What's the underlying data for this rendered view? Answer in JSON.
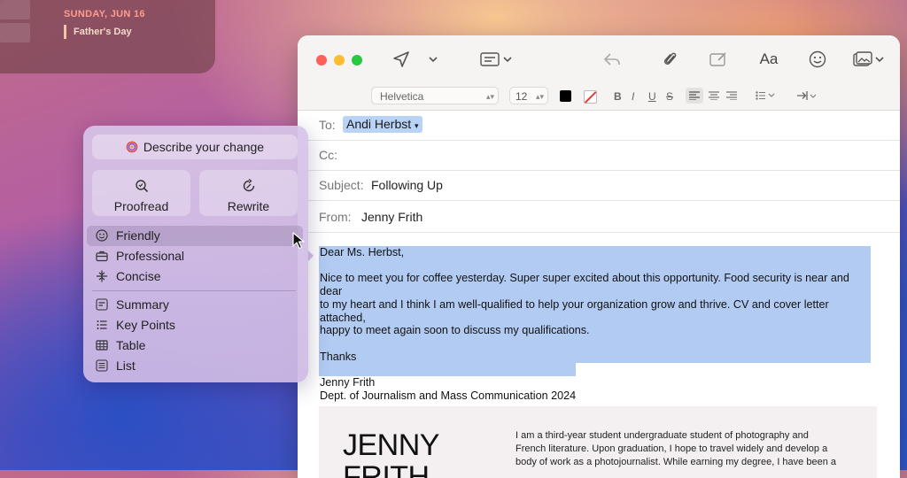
{
  "calendar_widget": {
    "date": "SUNDAY, JUN 16",
    "event": "Father's Day"
  },
  "mail": {
    "toolbar": {
      "send_icon": "paper-plane-icon",
      "header_fields_icon": "list-icon",
      "reply_icon": "reply-icon",
      "attach_icon": "paperclip-icon",
      "markup_icon": "compose-icon",
      "format_label": "Aa",
      "emoji_icon": "smiley-icon",
      "photo_icon": "photo-icon"
    },
    "format_bar": {
      "font": "Helvetica",
      "size": "12",
      "text_color": "#000000",
      "bold": "B",
      "italic": "I",
      "underline": "U",
      "strike": "S"
    },
    "to_label": "To:",
    "to_value": "Andi Herbst",
    "cc_label": "Cc:",
    "subject_label": "Subject:",
    "subject_value": "Following Up",
    "from_label": "From:",
    "from_value": "Jenny Frith",
    "body": {
      "greeting": "Dear Ms. Herbst,",
      "paragraph1_line1": "Nice to meet you for coffee yesterday. Super super excited about this opportunity. Food security is near and dear",
      "paragraph1_line2": "to my heart and I think I am well-qualified to help your organization grow and thrive. CV and cover letter attached,",
      "paragraph1_line3": "happy to meet again soon to discuss my qualifications.",
      "closing": "Thanks",
      "signature_name": "Jenny Frith",
      "signature_dept": "Dept. of Journalism and Mass Communication 2024"
    },
    "attachment_preview": {
      "name_line1": "JENNY",
      "name_line2": "FRITH",
      "bio_line1": "I am a third-year student undergraduate student of photography and",
      "bio_line2": "French literature. Upon graduation, I hope to travel widely and develop a",
      "bio_line3": "body of work as a photojournalist. While earning my degree, I have been a"
    }
  },
  "writing_tools": {
    "describe_label": "Describe your change",
    "proofread_label": "Proofread",
    "rewrite_label": "Rewrite",
    "tones": [
      {
        "label": "Friendly",
        "icon": "smiley-icon",
        "selected": true
      },
      {
        "label": "Professional",
        "icon": "briefcase-icon",
        "selected": false
      },
      {
        "label": "Concise",
        "icon": "concise-icon",
        "selected": false
      }
    ],
    "formats": [
      {
        "label": "Summary",
        "icon": "summary-icon"
      },
      {
        "label": "Key Points",
        "icon": "bullet-list-icon"
      },
      {
        "label": "Table",
        "icon": "table-icon"
      },
      {
        "label": "List",
        "icon": "list-icon"
      }
    ]
  }
}
